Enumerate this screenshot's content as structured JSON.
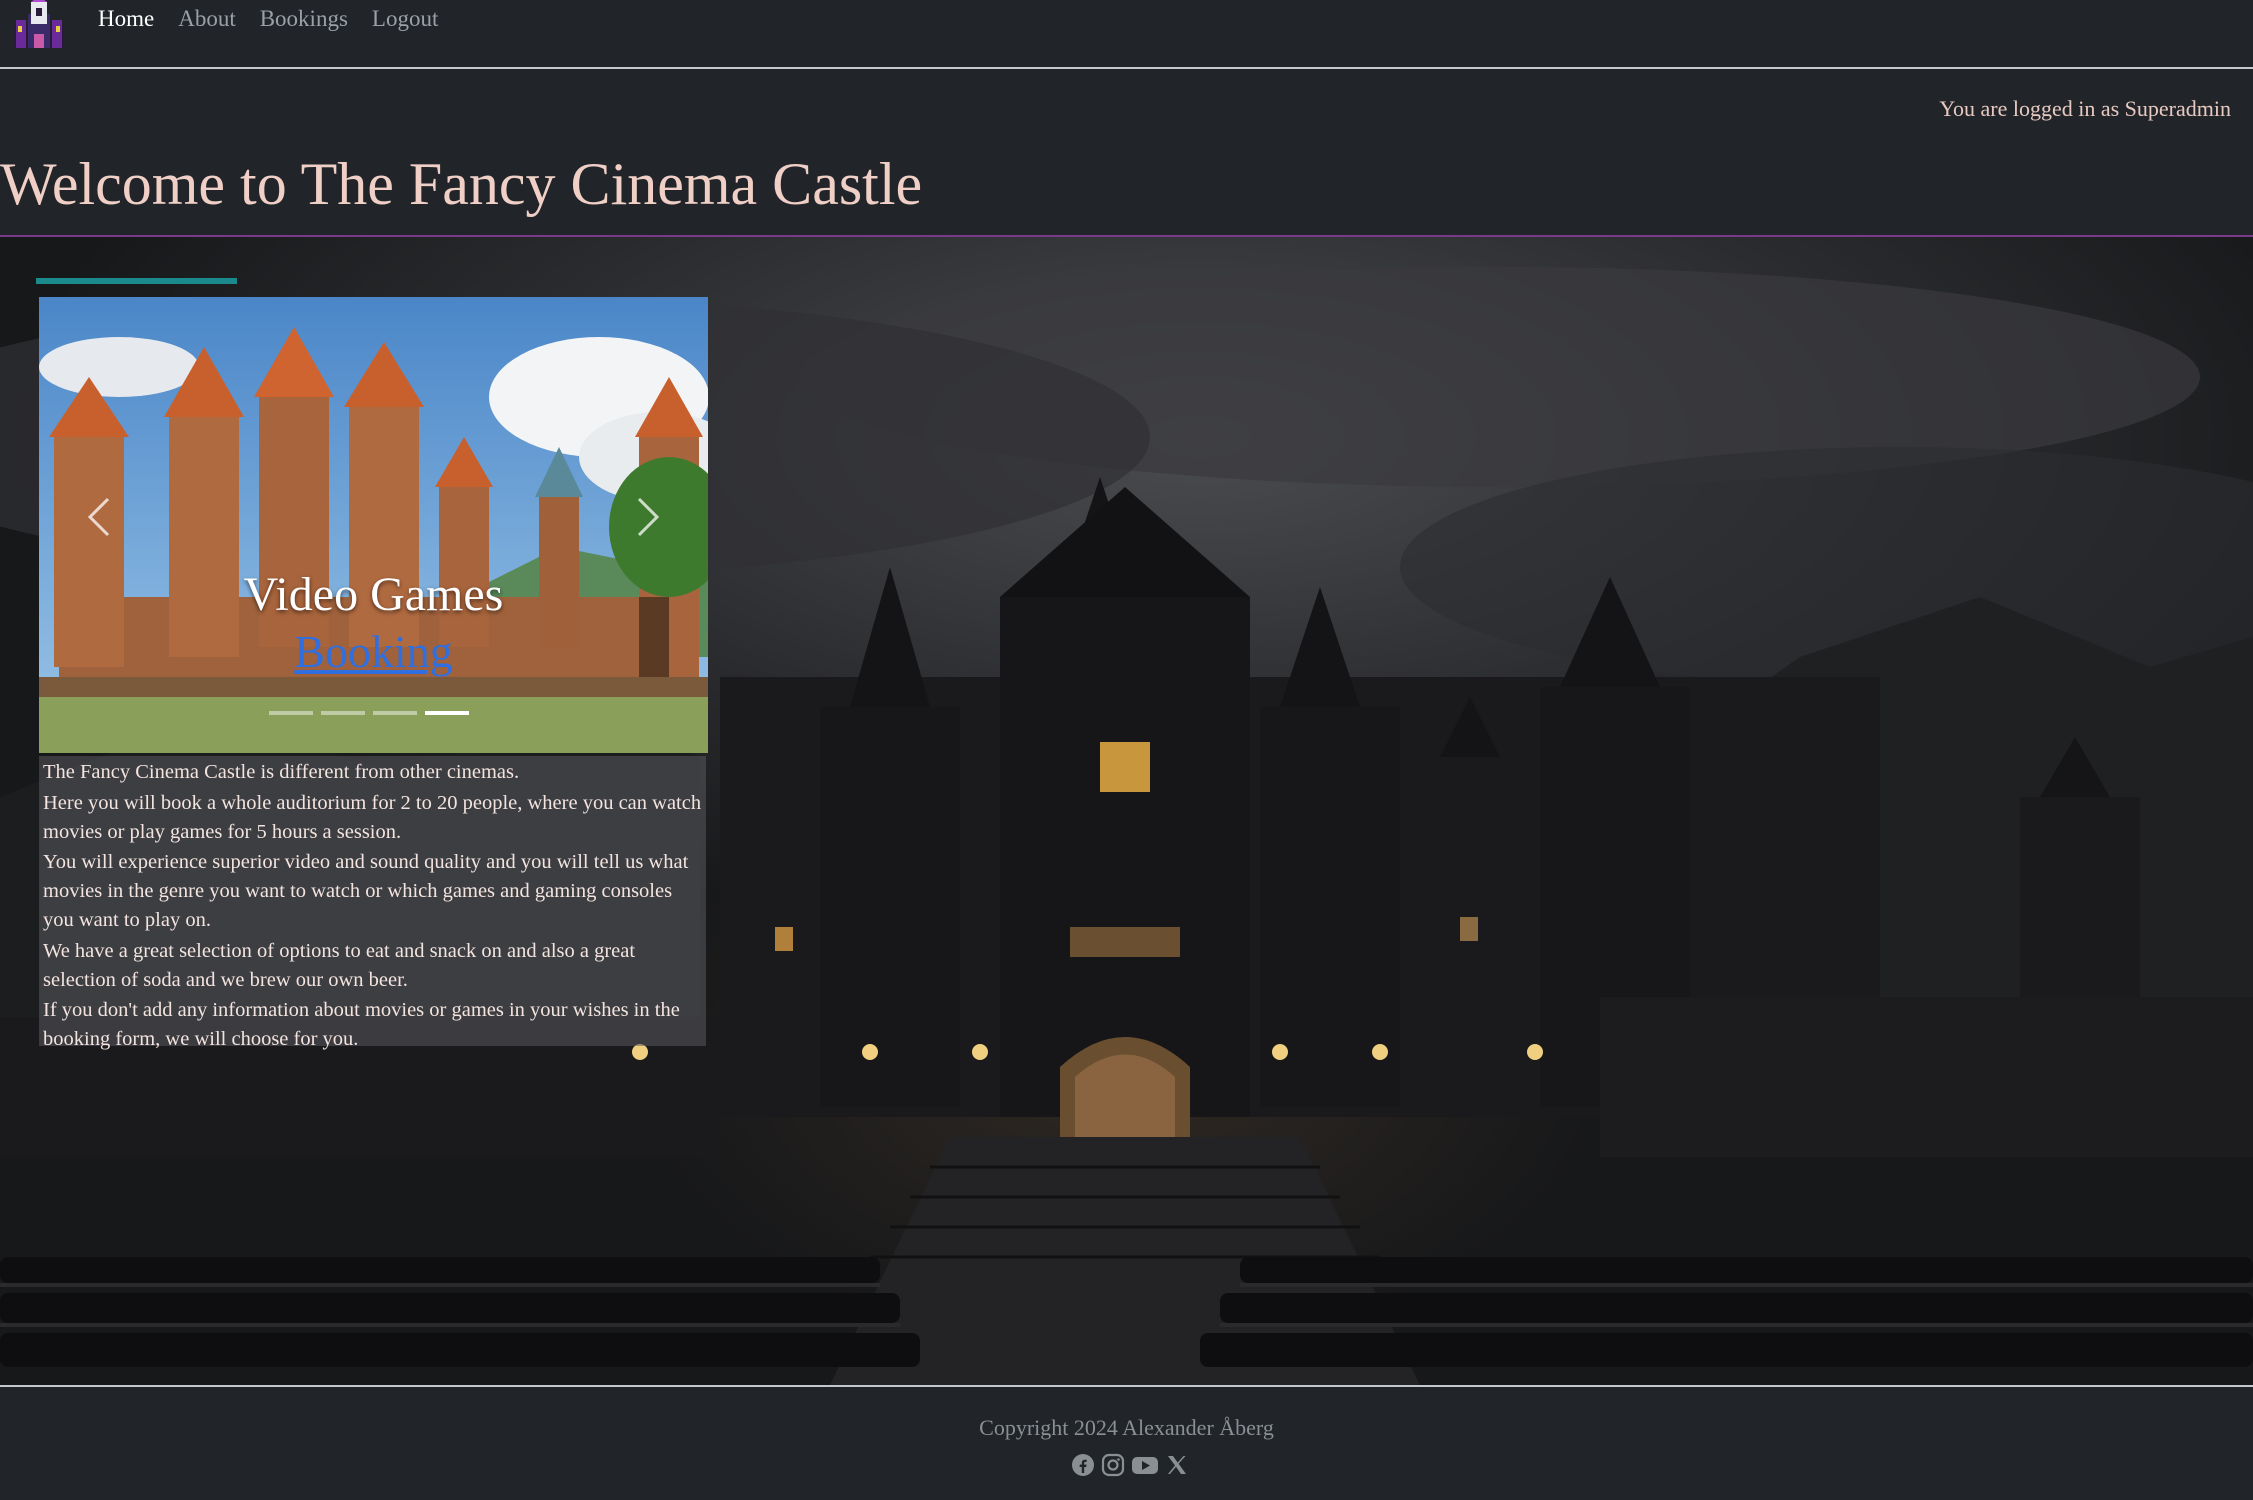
{
  "nav": {
    "items": [
      {
        "label": "Home",
        "active": true
      },
      {
        "label": "About",
        "active": false
      },
      {
        "label": "Bookings",
        "active": false
      },
      {
        "label": "Logout",
        "active": false
      }
    ]
  },
  "header": {
    "login_status": "You are logged in as Superadmin",
    "title": "Welcome to The Fancy Cinema Castle"
  },
  "carousel": {
    "caption_title": "Video Games",
    "caption_link": "Booking",
    "slide_count": 4,
    "active_slide": 4
  },
  "intro": {
    "paragraphs": [
      "The Fancy Cinema Castle is different from other cinemas.",
      "Here you will book a whole auditorium for 2 to 20 people, where you can watch movies or play games for 5 hours a session.",
      "You will experience superior video and sound quality and you will tell us what movies in the genre you want to watch or which games and gaming consoles you want to play on.",
      "We have a great selection of options to eat and snack on and also a great selection of soda and we brew our own beer.",
      "If you don't add any information about movies or games in your wishes in the booking form, we will choose for you."
    ]
  },
  "footer": {
    "copyright": "Copyright 2024 Alexander Åberg",
    "social_icons": [
      "facebook-icon",
      "instagram-icon",
      "youtube-icon",
      "x-twitter-icon"
    ]
  },
  "colors": {
    "background": "#212529",
    "title": "#f0cfc6",
    "accent_bar": "#1a8a8c",
    "divider": "#7a3a8a",
    "link": "#2f6fe0"
  }
}
